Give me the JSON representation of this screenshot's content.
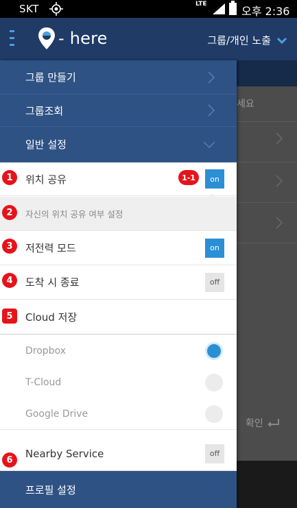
{
  "status_bar": {
    "carrier": "SKT",
    "network": "LTE",
    "time": "오후 2:36"
  },
  "header": {
    "logo_text": "- here",
    "visibility_label": "그룹/개인 노출"
  },
  "background": {
    "hint_text": "세요",
    "confirm_label": "확인"
  },
  "menu": {
    "create_group": "그룹 만들기",
    "group_lookup": "그룹조회",
    "general_settings": "일반 설정",
    "profile_settings": "프로필 설정"
  },
  "settings": {
    "location_share": {
      "label": "위치 공유",
      "toggle": "on"
    },
    "location_share_desc": "자신의 위치 공유 여부 설정",
    "low_power": {
      "label": "저전력 모드",
      "toggle": "on"
    },
    "end_on_arrival": {
      "label": "도착 시 종료",
      "toggle": "off"
    },
    "cloud": {
      "label": "Cloud 저장"
    },
    "cloud_options": [
      {
        "label": "Dropbox",
        "selected": true
      },
      {
        "label": "T-Cloud",
        "selected": false
      },
      {
        "label": "Google Drive",
        "selected": false
      }
    ],
    "nearby": {
      "label": "Nearby Service",
      "toggle": "off"
    }
  },
  "annotations": {
    "b1": "1",
    "b1_1": "1-1",
    "b2": "2",
    "b3": "3",
    "b4": "4",
    "b5": "5",
    "b6": "6"
  },
  "colors": {
    "header": "#1f3b66",
    "menu": "#2f5284",
    "accent": "#2b8fd6",
    "badge": "#e5141a"
  }
}
